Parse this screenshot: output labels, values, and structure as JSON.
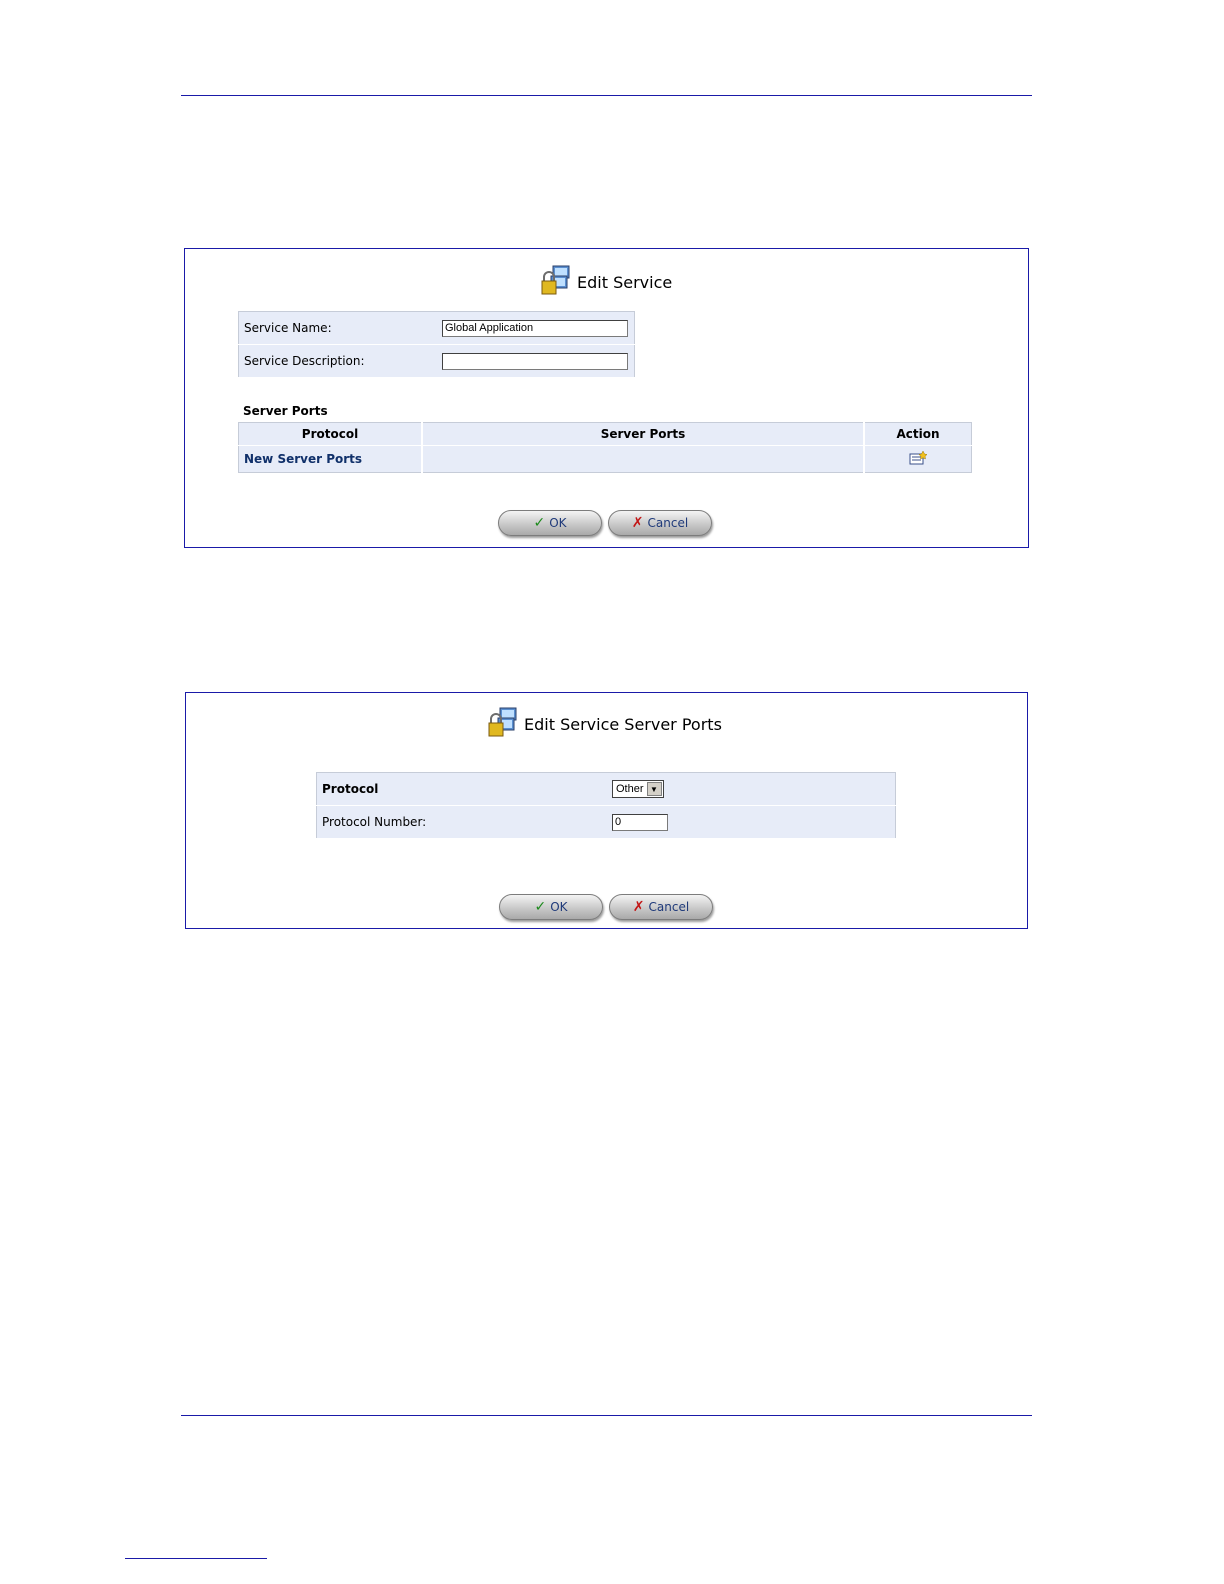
{
  "edit_service": {
    "title": "Edit Service",
    "icon": "service-lock-icon",
    "service_name_label": "Service Name:",
    "service_name_value": "Global Application",
    "service_description_label": "Service Description:",
    "service_description_value": "",
    "server_ports_section": "Server Ports",
    "columns": [
      "Protocol",
      "Server Ports",
      "Action"
    ],
    "rows": [
      {
        "protocol": "New Server Ports",
        "server_ports": "",
        "action_icon": "new-entry-icon"
      }
    ],
    "ok_label": "OK",
    "cancel_label": "Cancel"
  },
  "edit_server_ports": {
    "title": "Edit Service Server Ports",
    "icon": "service-lock-icon",
    "protocol_label": "Protocol",
    "protocol_value": "Other",
    "protocol_number_label": "Protocol Number:",
    "protocol_number_value": "0",
    "ok_label": "OK",
    "cancel_label": "Cancel"
  },
  "colors": {
    "frame": "#1a1aa8",
    "row_bg": "#e7ecf8",
    "link": "#10306a"
  }
}
